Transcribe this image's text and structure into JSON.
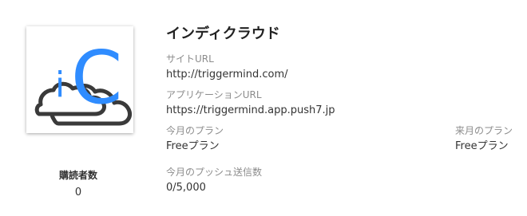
{
  "app": {
    "name": "インディクラウド",
    "logo_letters": [
      "i",
      "C"
    ],
    "colors": {
      "accent": "#2f8cff",
      "cloud_stroke": "#3a3a3a"
    }
  },
  "stats": {
    "subscribers_label": "購読者数",
    "subscribers_value": "0"
  },
  "fields": {
    "site_url_label": "サイトURL",
    "site_url_value": "http://triggermind.com/",
    "app_url_label": "アプリケーションURL",
    "app_url_value": "https://triggermind.app.push7.jp",
    "current_plan_label": "今月のプラン",
    "current_plan_value": "Freeプラン",
    "next_plan_label": "来月のプラン",
    "next_plan_value": "Freeプラン",
    "push_count_label": "今月のプッシュ送信数",
    "push_count_value": "0/5,000"
  }
}
